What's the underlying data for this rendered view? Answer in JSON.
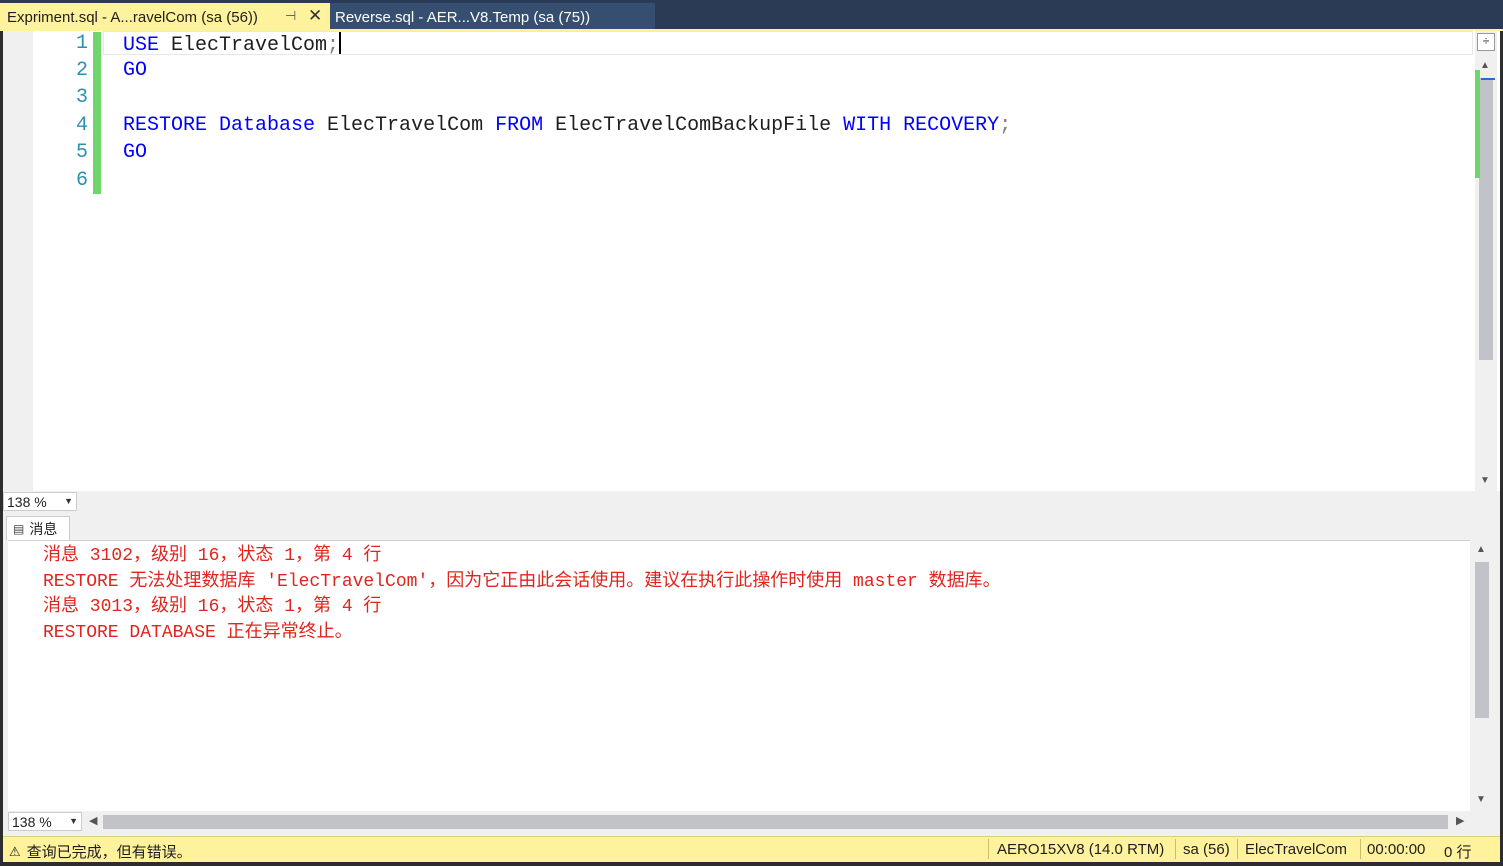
{
  "tabs": [
    {
      "label": "Expriment.sql - A...ravelCom (sa (56))",
      "active": true,
      "pin": "⊣",
      "close": "✕"
    },
    {
      "label": "Reverse.sql - AER...V8.Temp (sa (75))",
      "active": false
    }
  ],
  "editor": {
    "line_numbers": [
      "1",
      "2",
      "3",
      "4",
      "5",
      "6"
    ],
    "lines": [
      {
        "kw1": "USE",
        "id1": " ElecTravelCom",
        "gray1": ";"
      },
      {
        "kw1": "GO"
      },
      {},
      {
        "kw1": "RESTORE",
        "kw2": " Database",
        "id1": " ElecTravelCom",
        "kw3": " FROM",
        "id2": " ElecTravelComBackupFile",
        "kw4": " WITH",
        "kw5": " RECOVERY",
        "gray1": ";"
      },
      {
        "kw1": "GO"
      },
      {}
    ],
    "split_icon": "÷",
    "scroll_up": "▲",
    "scroll_down": "▼"
  },
  "zoom": {
    "value": "138 %",
    "arrow": "▼"
  },
  "results": {
    "tab_label": "消息",
    "tab_icon": "▤",
    "messages": [
      "消息 3102，级别 16，状态 1，第 4 行",
      "RESTORE 无法处理数据库 'ElecTravelCom'，因为它正由此会话使用。建议在执行此操作时使用 master 数据库。",
      "消息 3013，级别 16，状态 1，第 4 行",
      "RESTORE DATABASE 正在异常终止。"
    ],
    "zoom": "138 %",
    "scroll_left": "◀",
    "scroll_right": "▶"
  },
  "status_bar": {
    "warning_icon": "⚠",
    "text": "查询已完成，但有错误。",
    "server": "AERO15XV8 (14.0 RTM)",
    "user": "sa (56)",
    "database": "ElecTravelCom",
    "elapsed": "00:00:00",
    "rows": "0 行"
  },
  "colors": {
    "accent_tab": "#fff29d",
    "keyword": "#0000ff",
    "error_text": "#e0241e",
    "line_number": "#2b91af",
    "change_bar": "#6cd66c"
  }
}
